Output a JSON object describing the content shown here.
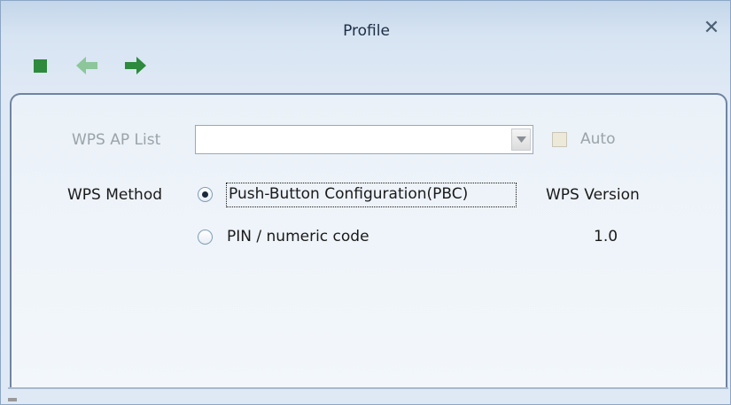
{
  "window": {
    "title": "Profile"
  },
  "toolbar": {
    "stop_icon": "stop-square-icon",
    "back_icon": "arrow-left-icon",
    "forward_icon": "arrow-right-icon"
  },
  "form": {
    "wps_ap_list_label": "WPS AP List",
    "wps_ap_list_value": "",
    "auto_label": "Auto",
    "auto_checked": false,
    "wps_method_label": "WPS Method",
    "method_options": [
      {
        "label": "Push-Button Configuration(PBC)",
        "selected": true
      },
      {
        "label": "PIN / numeric code",
        "selected": false
      }
    ],
    "wps_version_label": "WPS Version",
    "wps_version_value": "1.0"
  },
  "colors": {
    "accent_green": "#2e8a3c",
    "disabled_arrow": "#8cc69a"
  }
}
